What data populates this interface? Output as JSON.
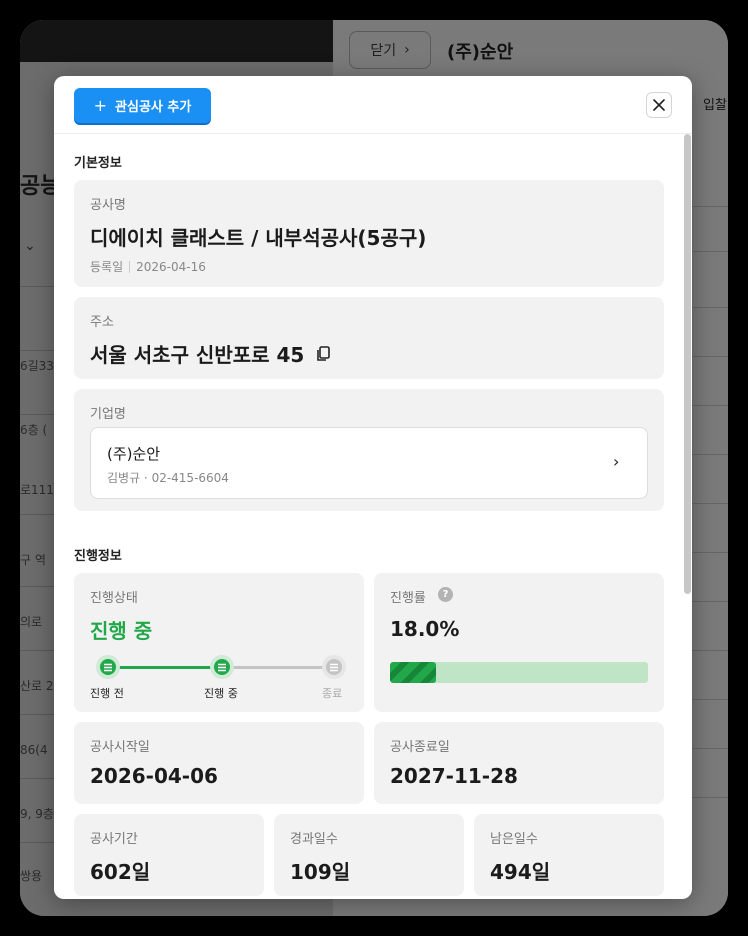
{
  "background": {
    "left_title": "공능",
    "left_rows": [
      "6길33,",
      "6층 (",
      "로111",
      "구 역",
      "의로",
      "산로 2",
      "86(4",
      "9, 9층",
      "쌍용"
    ],
    "close_label": "닫기",
    "company_title": "(주)순안",
    "tab_label": "입찰"
  },
  "modal": {
    "add_button_label": "관심공사 추가",
    "basic_section_title": "기본정보",
    "project": {
      "label": "공사명",
      "name": "디에이치 클래스트 / 내부석공사(5공구)",
      "registered_label": "등록일",
      "registered_date": "2026-04-16"
    },
    "address": {
      "label": "주소",
      "value": "서울 서초구 신반포로 45"
    },
    "company": {
      "label": "기업명",
      "name": "(주)순안",
      "contact": "김병규 · 02-415-6604"
    },
    "progress_section_title": "진행정보",
    "status": {
      "label": "진행상태",
      "value": "진행 중",
      "steps": [
        "진행 전",
        "진행 중",
        "종료"
      ],
      "current_step": 1
    },
    "rate": {
      "label": "진행률",
      "value_text": "18.0%",
      "value": 18.0
    },
    "start": {
      "label": "공사시작일",
      "value": "2026-04-06"
    },
    "end": {
      "label": "공사종료일",
      "value": "2027-11-28"
    },
    "duration": {
      "label": "공사기간",
      "value": "602일"
    },
    "elapsed": {
      "label": "경과일수",
      "value": "109일"
    },
    "remaining": {
      "label": "남은일수",
      "value": "494일"
    }
  },
  "colors": {
    "accent_blue": "#1a90f5",
    "status_green": "#22a84a",
    "progress_track": "#bfe4c6",
    "step_inactive": "#c4c4c4"
  },
  "icons": {
    "add": "plus-icon",
    "close": "close-icon",
    "copy": "copy-icon",
    "chevron": "chevron-right-icon",
    "help": "help-icon",
    "step": "step-list-icon"
  }
}
